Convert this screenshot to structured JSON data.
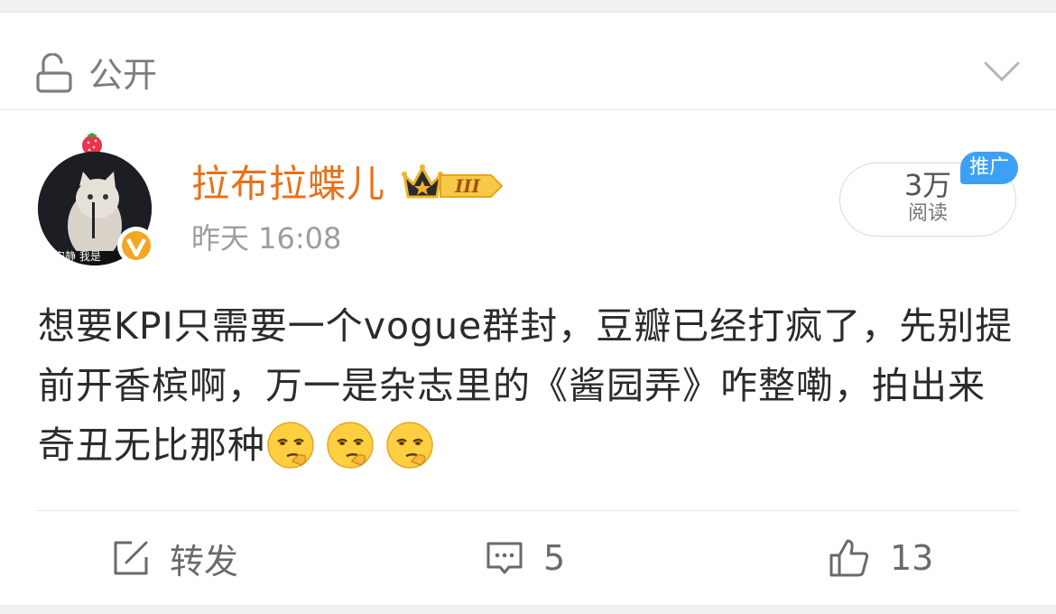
{
  "visibility": {
    "label": "公开",
    "icon": "unlock-icon"
  },
  "post": {
    "author": "拉布拉蝶儿",
    "avatar_caption": "安静 我是",
    "time": "昨天 16:08",
    "reads_count": "3万",
    "reads_label": "阅读",
    "promo": "推广",
    "level_badge": "III",
    "text": "想要KPI只需要一个vogue群封，豆瓣已经打疯了，先别提前开香槟啊，万一是杂志里的《酱园弄》咋整嘞，拍出来奇丑无比那种"
  },
  "actions": {
    "repost_label": "转发",
    "comment_count": "5",
    "like_count": "13"
  },
  "colors": {
    "username": "#e8711a",
    "promo": "#3da0f5",
    "vip_badge": "#f5a623"
  }
}
